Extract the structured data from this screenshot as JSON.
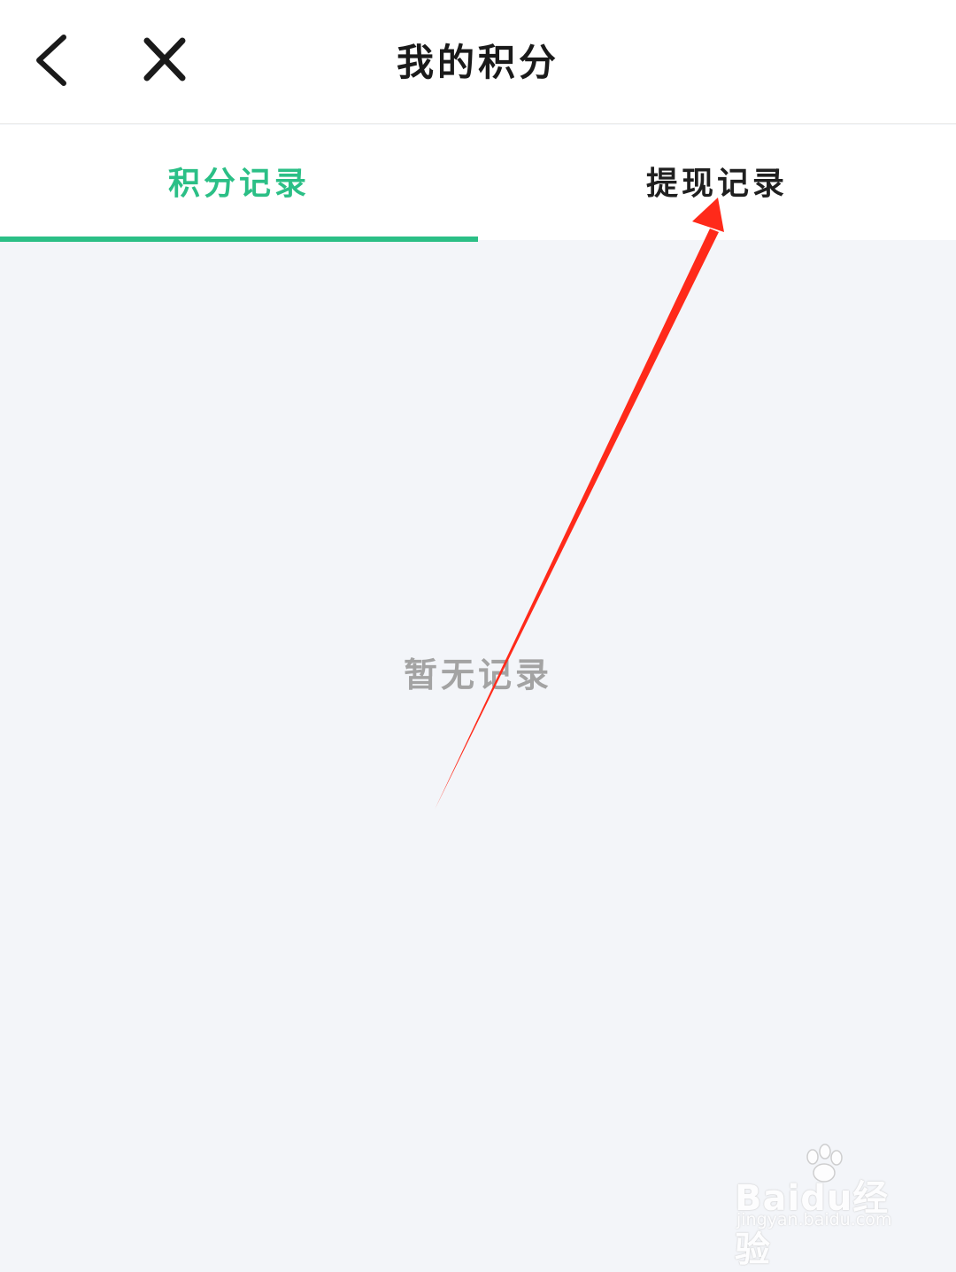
{
  "header": {
    "title": "我的积分"
  },
  "tabs": [
    {
      "label": "积分记录",
      "active": true
    },
    {
      "label": "提现记录",
      "active": false
    }
  ],
  "empty_state": {
    "text": "暂无记录"
  },
  "colors": {
    "accent": "#2bbf86",
    "annotation_arrow": "#ff2a1a",
    "background": "#f3f5f9"
  },
  "watermark": {
    "logo": "Baidu经验",
    "url": "jingyan.baidu.com"
  }
}
